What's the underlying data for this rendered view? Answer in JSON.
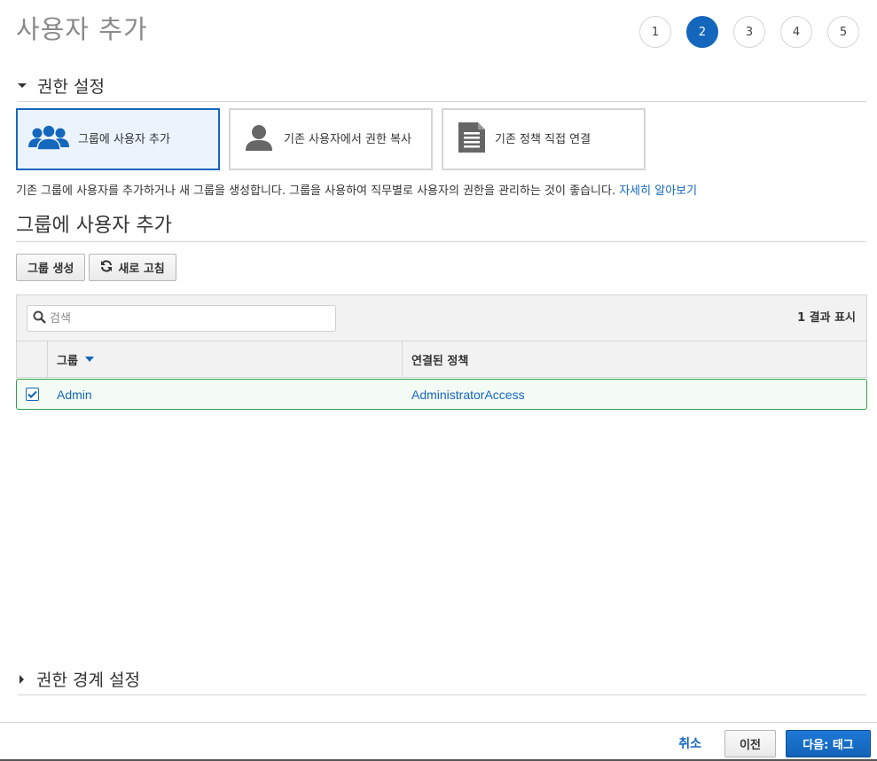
{
  "page": {
    "title": "사용자 추가"
  },
  "steps": [
    "1",
    "2",
    "3",
    "4",
    "5"
  ],
  "active_step": "2",
  "permissions": {
    "heading": "권한 설정",
    "options": [
      {
        "label": "그룹에 사용자 추가",
        "icon": "users-group-icon",
        "selected": true
      },
      {
        "label": "기존 사용자에서 권한 복사",
        "icon": "user-icon",
        "selected": false
      },
      {
        "label": "기존 정책 직접 연결",
        "icon": "document-icon",
        "selected": false
      }
    ],
    "description": "기존 그룹에 사용자를 추가하거나 새 그룹을 생성합니다. 그룹을 사용하여 직무별로 사용자의 권한을 관리하는 것이 좋습니다.",
    "learn_more": "자세히 알아보기"
  },
  "group_section": {
    "heading": "그룹에 사용자 추가",
    "create_group_label": "그룹 생성",
    "refresh_label": "새로 고침",
    "search_placeholder": "검색",
    "result_count": "1 결과 표시",
    "columns": {
      "group": "그룹",
      "policy": "연결된 정책"
    },
    "rows": [
      {
        "group": "Admin",
        "policy": "AdministratorAccess",
        "checked": true
      }
    ]
  },
  "boundary": {
    "heading": "권한 경계 설정"
  },
  "footer": {
    "cancel": "취소",
    "previous": "이전",
    "next": "다음: 태그"
  },
  "colors": {
    "accent": "#1567bd",
    "selected_row_border": "#2ea24b"
  }
}
